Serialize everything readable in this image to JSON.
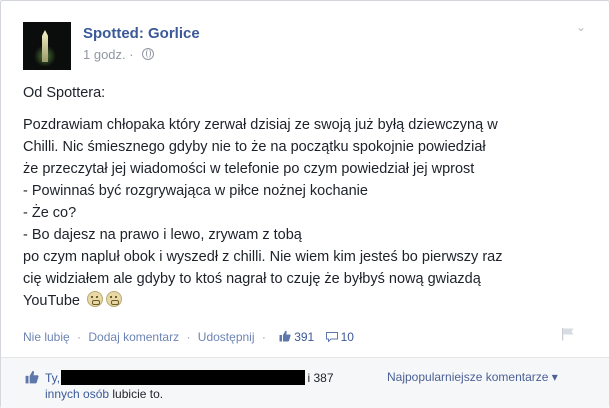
{
  "post": {
    "page_name": "Spotted: Gorlice",
    "time": "1 godz.",
    "menu_icon": "chevron-down-icon",
    "privacy_icon": "globe-icon",
    "lines": [
      "Od Spottera:",
      "",
      "Pozdrawiam chłopaka który zerwał dzisiaj ze swoją już byłą dziewczyną w",
      "Chilli. Nic śmiesznego gdyby nie to że na początku spokojnie powiedział",
      "że przeczytał jej wiadomości w telefonie po czym powiedział jej wprost",
      "- Powinnaś być rozgrywająca w piłce nożnej kochanie",
      "- Że co?",
      "- Bo dajesz na prawo i lewo, zrywam z tobą",
      "po czym napluł obok i wyszedł z chilli. Nie wiem kim jesteś bo pierwszy raz",
      "cię widziałem ale gdyby to ktoś nagrał to czuję że byłbyś nową gwiazdą",
      "YouTube"
    ]
  },
  "actions": {
    "unlike": "Nie lubię",
    "comment": "Dodaj komentarz",
    "share": "Udostępnij",
    "likes_count": "391",
    "comments_count": "10",
    "dot": "·"
  },
  "likes": {
    "prefix": "Ty,",
    "suffix": "i 387",
    "line2_a": "innych osób",
    "line2_b": "lubicie to."
  },
  "sort": {
    "label": "Najpopularniejsze komentarze",
    "arrow": "▾"
  },
  "colors": {
    "link": "#3b5998",
    "background": "#e9ebee",
    "card": "#ffffff"
  }
}
